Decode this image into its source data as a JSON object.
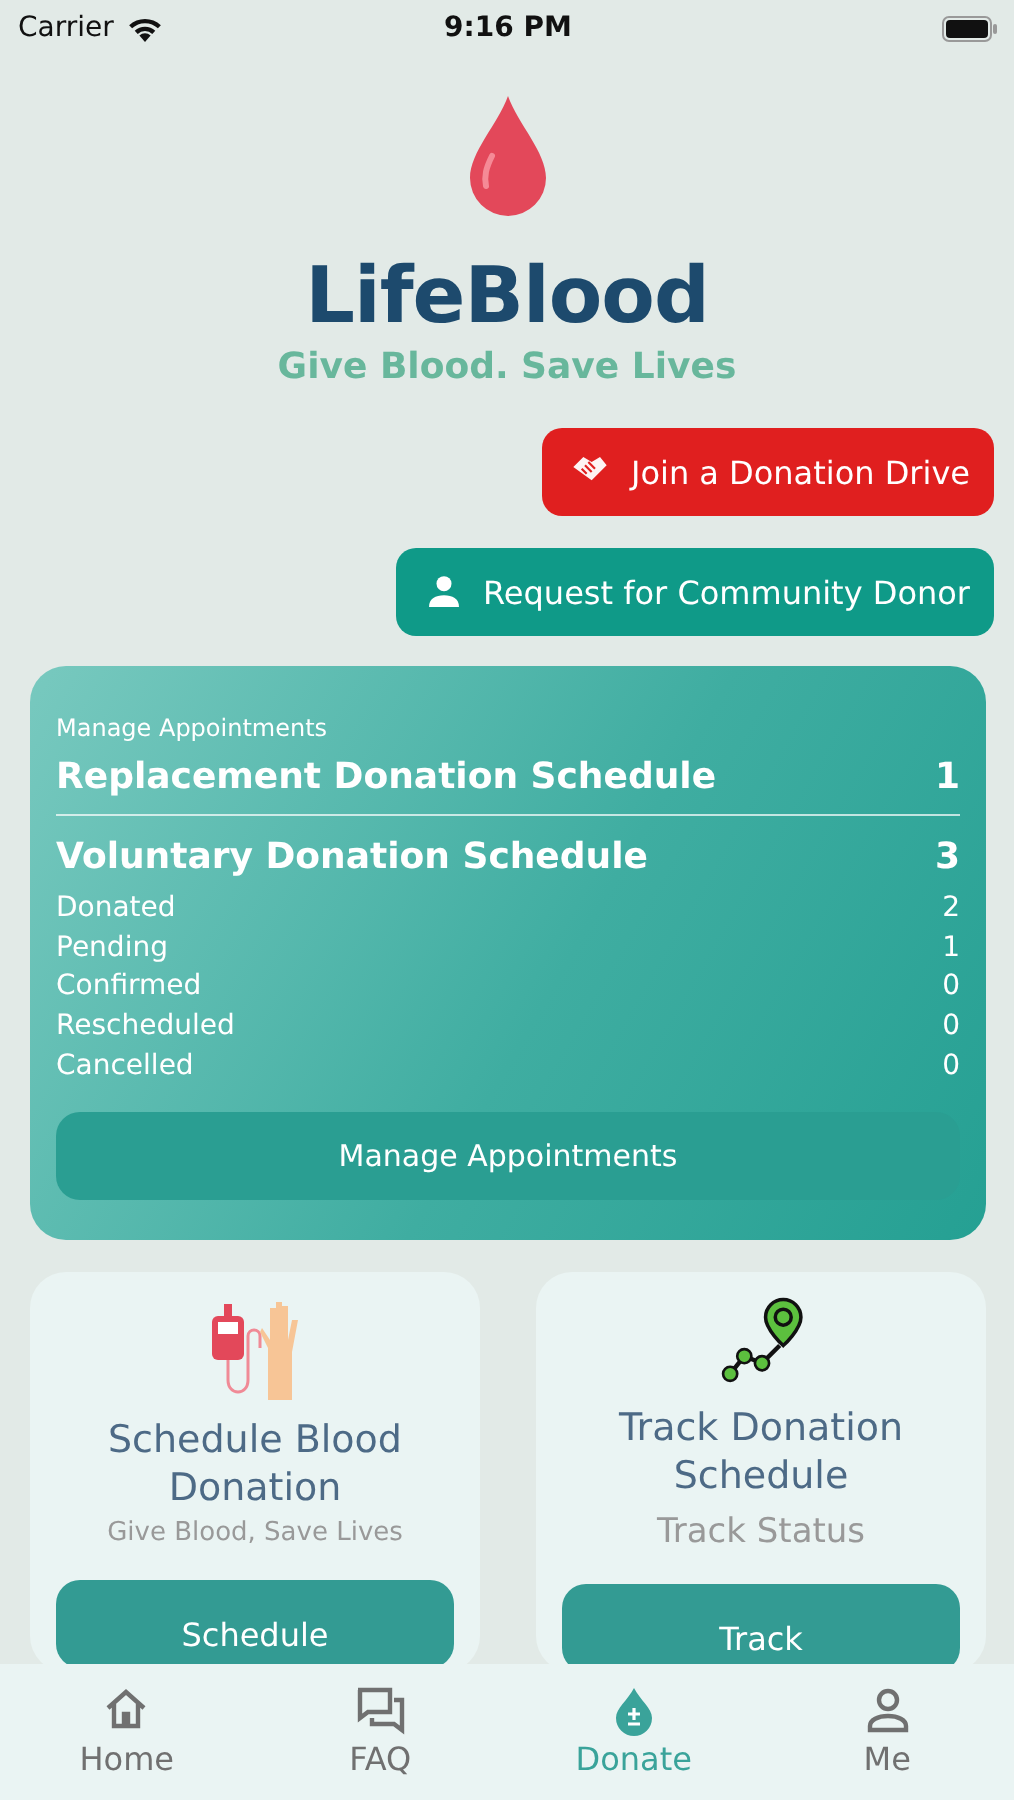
{
  "status_bar": {
    "carrier": "Carrier",
    "time": "9:16 PM"
  },
  "brand": {
    "title": "LifeBlood",
    "tagline": "Give Blood. Save Lives"
  },
  "actions": [
    {
      "kind": "drive",
      "label": "Join a Donation Drive"
    },
    {
      "kind": "donor",
      "label": "Request for Community Donor"
    }
  ],
  "summary": {
    "caption": "Manage Appointments",
    "headlines": [
      {
        "label": "Replacement Donation Schedule",
        "count": "1"
      },
      {
        "label": "Voluntary Donation Schedule",
        "count": "3"
      }
    ],
    "rows": [
      {
        "label": "Donated",
        "count": "2"
      },
      {
        "label": "Pending",
        "count": "1"
      },
      {
        "label": "Confirmed",
        "count": "0"
      },
      {
        "label": "Rescheduled",
        "count": "0"
      },
      {
        "label": "Cancelled",
        "count": "0"
      }
    ],
    "button": "Manage Appointments"
  },
  "cards": [
    {
      "kind": "schedule",
      "title": "Schedule Blood Donation",
      "subtitle": "Give Blood, Save Lives",
      "button": "Schedule"
    },
    {
      "kind": "track",
      "title": "Track Donation Schedule",
      "subtitle": "Track Status",
      "button": "Track"
    }
  ],
  "tab_bar": [
    {
      "kind": "home",
      "label": "Home",
      "selected": false
    },
    {
      "kind": "faq",
      "label": "FAQ",
      "selected": false
    },
    {
      "kind": "donate",
      "label": "Donate",
      "selected": true
    },
    {
      "kind": "me",
      "label": "Me",
      "selected": false
    }
  ]
}
